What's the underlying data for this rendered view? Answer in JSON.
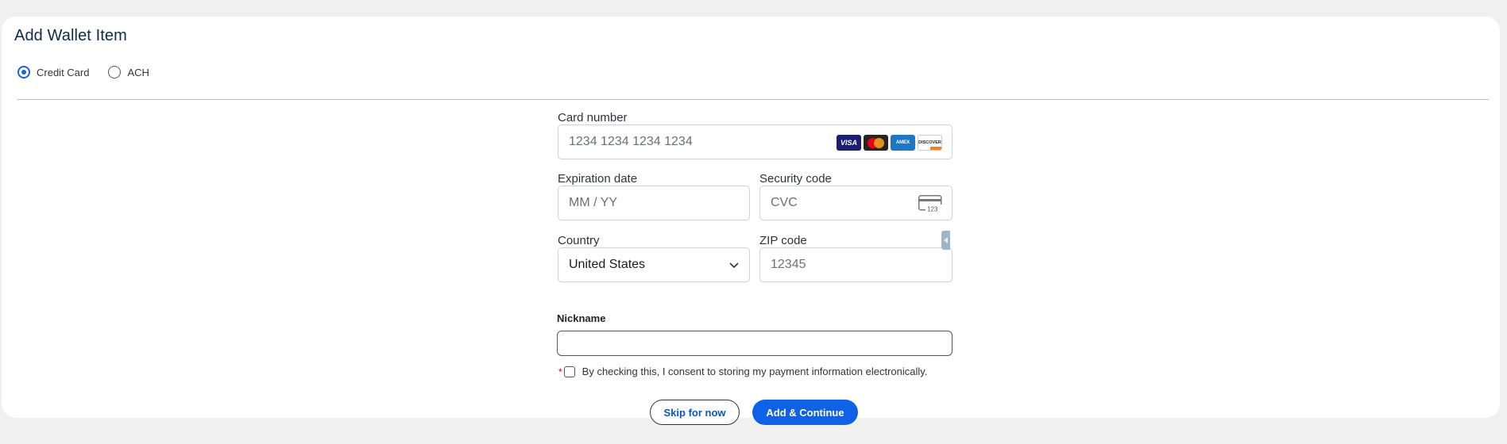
{
  "page": {
    "title": "Add Wallet Item",
    "payment_types": [
      {
        "label": "Credit Card",
        "selected": true
      },
      {
        "label": "ACH",
        "selected": false
      }
    ]
  },
  "card_form": {
    "card_number_label": "Card number",
    "card_number_placeholder": "1234 1234 1234 1234",
    "brands": [
      "VISA",
      "mastercard",
      "AMEX",
      "DISCOVER"
    ],
    "expiration_label": "Expiration date",
    "expiration_placeholder": "MM / YY",
    "security_label": "Security code",
    "security_placeholder": "CVC",
    "cvc_icon_text": "123",
    "country_label": "Country",
    "country_value": "United States",
    "zip_label": "ZIP code",
    "zip_placeholder": "12345"
  },
  "nickname": {
    "label": "Nickname",
    "value": ""
  },
  "consent": {
    "required_mark": "*",
    "text": "By checking this, I consent to storing my payment information electronically.",
    "checked": false
  },
  "actions": {
    "skip_label": "Skip for now",
    "add_label": "Add & Continue"
  },
  "colors": {
    "accent": "#0f62e8",
    "radio_selected": "#1a63d9",
    "required": "#d0021b",
    "background": "#f0f0f0"
  }
}
